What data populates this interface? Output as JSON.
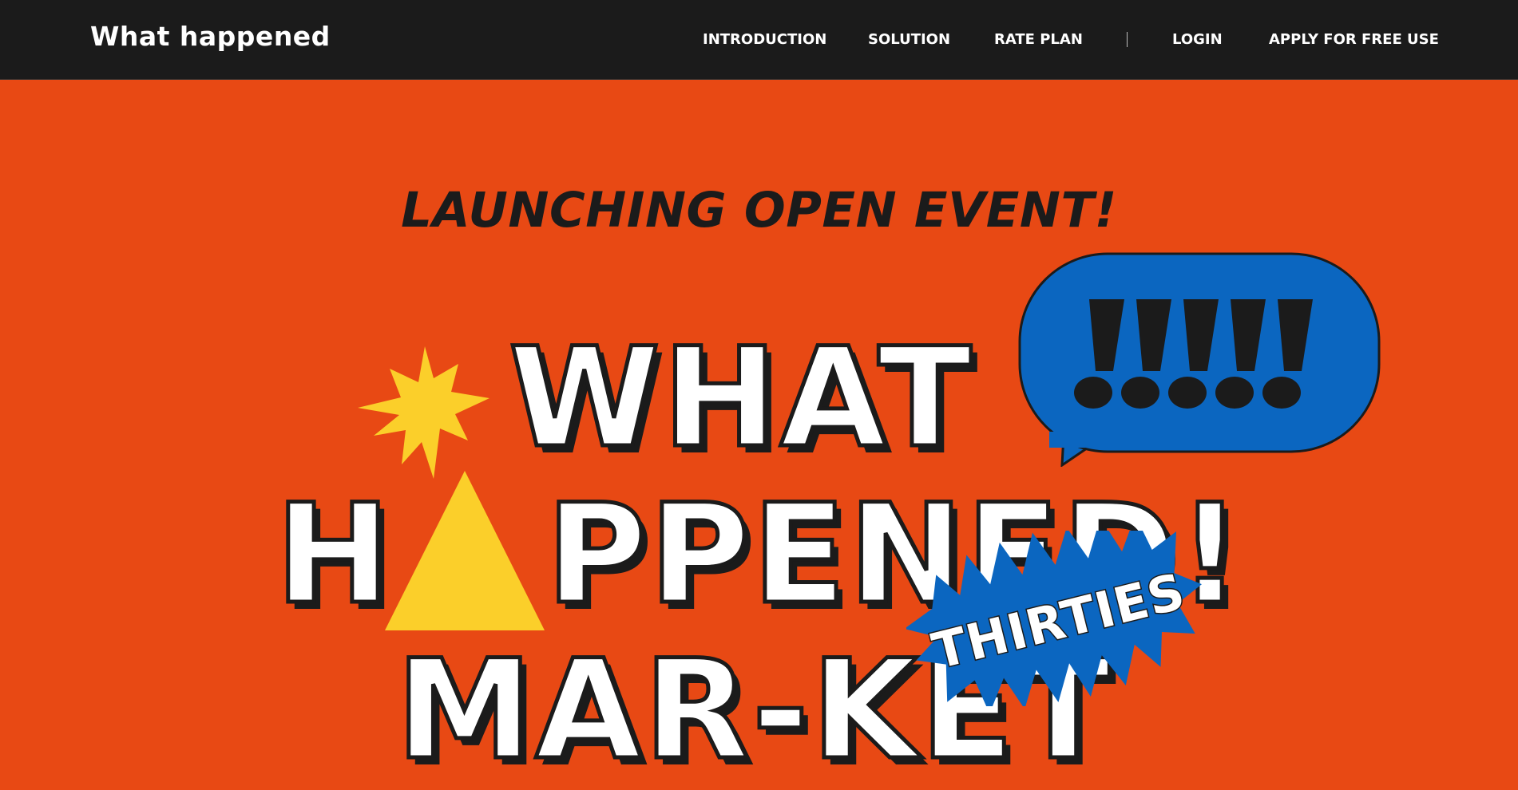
{
  "header": {
    "brand": "What happened",
    "nav": {
      "introduction": "INTRODUCTION",
      "solution": "SOLUTION",
      "rate_plan": "RATE PLAN",
      "login": "LOGIN",
      "apply": "APPLY FOR FREE USE"
    }
  },
  "hero": {
    "subtitle": "LAUNCHING OPEN EVENT!",
    "line1": "WHAT",
    "line2_start": "H",
    "line2_end": "PPENED!",
    "line3": "MAR-KET",
    "bubble_text": "!!!!!",
    "badge_text": "THIRTIES"
  },
  "colors": {
    "background": "#e84914",
    "nav_bg": "#1b1b1b",
    "yellow": "#fbcf2a",
    "blue": "#0b66c0",
    "ink": "#1b1b1b",
    "white": "#ffffff"
  },
  "icons": {
    "starburst": "yellow-starburst-icon",
    "triangle": "yellow-triangle-icon",
    "bubble": "speech-bubble-icon",
    "badge": "jagged-badge-icon"
  }
}
